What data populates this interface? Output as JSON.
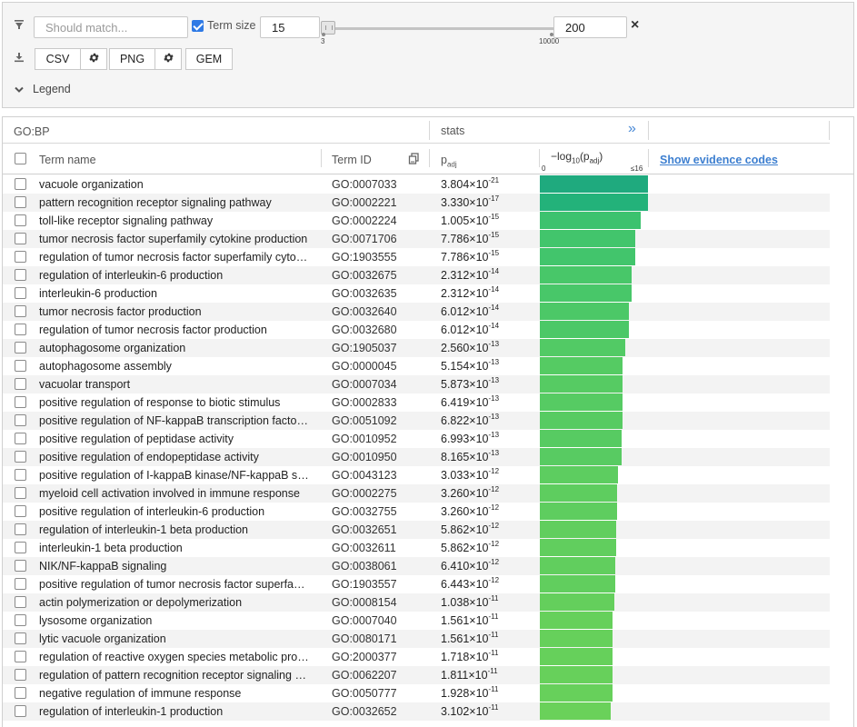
{
  "filters": {
    "search_placeholder": "Should match...",
    "term_size_label": "Term size",
    "term_size_checked": true,
    "term_size_min": "15",
    "term_size_max": "200",
    "slider_min_label": "3",
    "slider_max_label": "10000",
    "clear_icon": "×",
    "export_buttons": [
      "CSV",
      "PNG",
      "GEM"
    ],
    "legend_label": "Legend"
  },
  "table": {
    "source_label": "GO:BP",
    "stats_label": "stats",
    "expand_icon": "»",
    "col_term_name": "Term name",
    "col_term_id": "Term ID",
    "col_padj": "p",
    "col_padj_sub": "adj",
    "col_neglog_prefix": "−log",
    "col_neglog_sub": "10",
    "col_neglog_inner": "(p",
    "col_neglog_inner_sub": "adj",
    "col_neglog_close": ")",
    "axis_min": "0",
    "axis_max": "≤16",
    "show_evidence": "Show evidence codes",
    "rows": [
      {
        "name": "vacuole organization",
        "id": "GO:0007033",
        "mant": "3.804",
        "exp": "-21",
        "neglog": 20.42,
        "color": "#1faa7e"
      },
      {
        "name": "pattern recognition receptor signaling pathway",
        "id": "GO:0002221",
        "mant": "3.330",
        "exp": "-17",
        "neglog": 16.48,
        "color": "#23b27a"
      },
      {
        "name": "toll-like receptor signaling pathway",
        "id": "GO:0002224",
        "mant": "1.005",
        "exp": "-15",
        "neglog": 14.99,
        "color": "#3cc26e"
      },
      {
        "name": "tumor necrosis factor superfamily cytokine production",
        "id": "GO:0071706",
        "mant": "7.786",
        "exp": "-15",
        "neglog": 14.11,
        "color": "#42c56c"
      },
      {
        "name": "regulation of tumor necrosis factor superfamily cytokine production",
        "id": "GO:1903555",
        "mant": "7.786",
        "exp": "-15",
        "neglog": 14.11,
        "color": "#42c56c"
      },
      {
        "name": "regulation of interleukin-6 production",
        "id": "GO:0032675",
        "mant": "2.312",
        "exp": "-14",
        "neglog": 13.64,
        "color": "#48c769"
      },
      {
        "name": "interleukin-6 production",
        "id": "GO:0032635",
        "mant": "2.312",
        "exp": "-14",
        "neglog": 13.64,
        "color": "#48c769"
      },
      {
        "name": "tumor necrosis factor production",
        "id": "GO:0032640",
        "mant": "6.012",
        "exp": "-14",
        "neglog": 13.22,
        "color": "#4cc867"
      },
      {
        "name": "regulation of tumor necrosis factor production",
        "id": "GO:0032680",
        "mant": "6.012",
        "exp": "-14",
        "neglog": 13.22,
        "color": "#4cc867"
      },
      {
        "name": "autophagosome organization",
        "id": "GO:1905037",
        "mant": "2.560",
        "exp": "-13",
        "neglog": 12.59,
        "color": "#52ca65"
      },
      {
        "name": "autophagosome assembly",
        "id": "GO:0000045",
        "mant": "5.154",
        "exp": "-13",
        "neglog": 12.29,
        "color": "#55cb63"
      },
      {
        "name": "vacuolar transport",
        "id": "GO:0007034",
        "mant": "5.873",
        "exp": "-13",
        "neglog": 12.23,
        "color": "#56cb63"
      },
      {
        "name": "positive regulation of response to biotic stimulus",
        "id": "GO:0002833",
        "mant": "6.419",
        "exp": "-13",
        "neglog": 12.19,
        "color": "#56cb63"
      },
      {
        "name": "positive regulation of NF-kappaB transcription factor activity",
        "id": "GO:0051092",
        "mant": "6.822",
        "exp": "-13",
        "neglog": 12.17,
        "color": "#57cb62"
      },
      {
        "name": "positive regulation of peptidase activity",
        "id": "GO:0010952",
        "mant": "6.993",
        "exp": "-13",
        "neglog": 12.16,
        "color": "#57cb62"
      },
      {
        "name": "positive regulation of endopeptidase activity",
        "id": "GO:0010950",
        "mant": "8.165",
        "exp": "-13",
        "neglog": 12.09,
        "color": "#58cb62"
      },
      {
        "name": "positive regulation of I-kappaB kinase/NF-kappaB signaling",
        "id": "GO:0043123",
        "mant": "3.033",
        "exp": "-12",
        "neglog": 11.52,
        "color": "#5dcd60"
      },
      {
        "name": "myeloid cell activation involved in immune response",
        "id": "GO:0002275",
        "mant": "3.260",
        "exp": "-12",
        "neglog": 11.49,
        "color": "#5ecd5f"
      },
      {
        "name": "positive regulation of interleukin-6 production",
        "id": "GO:0032755",
        "mant": "3.260",
        "exp": "-12",
        "neglog": 11.49,
        "color": "#5ecd5f"
      },
      {
        "name": "regulation of interleukin-1 beta production",
        "id": "GO:0032651",
        "mant": "5.862",
        "exp": "-12",
        "neglog": 11.23,
        "color": "#61ce5e"
      },
      {
        "name": "interleukin-1 beta production",
        "id": "GO:0032611",
        "mant": "5.862",
        "exp": "-12",
        "neglog": 11.23,
        "color": "#61ce5e"
      },
      {
        "name": "NIK/NF-kappaB signaling",
        "id": "GO:0038061",
        "mant": "6.410",
        "exp": "-12",
        "neglog": 11.19,
        "color": "#61ce5e"
      },
      {
        "name": "positive regulation of tumor necrosis factor superfamily cytokine production",
        "id": "GO:1903557",
        "mant": "6.443",
        "exp": "-12",
        "neglog": 11.19,
        "color": "#61ce5e"
      },
      {
        "name": "actin polymerization or depolymerization",
        "id": "GO:0008154",
        "mant": "1.038",
        "exp": "-11",
        "neglog": 10.98,
        "color": "#64cf5c"
      },
      {
        "name": "lysosome organization",
        "id": "GO:0007040",
        "mant": "1.561",
        "exp": "-11",
        "neglog": 10.81,
        "color": "#66d05b"
      },
      {
        "name": "lytic vacuole organization",
        "id": "GO:0080171",
        "mant": "1.561",
        "exp": "-11",
        "neglog": 10.81,
        "color": "#66d05b"
      },
      {
        "name": "regulation of reactive oxygen species metabolic process",
        "id": "GO:2000377",
        "mant": "1.718",
        "exp": "-11",
        "neglog": 10.77,
        "color": "#66d05b"
      },
      {
        "name": "regulation of pattern recognition receptor signaling pathway",
        "id": "GO:0062207",
        "mant": "1.811",
        "exp": "-11",
        "neglog": 10.74,
        "color": "#67d05b"
      },
      {
        "name": "negative regulation of immune response",
        "id": "GO:0050777",
        "mant": "1.928",
        "exp": "-11",
        "neglog": 10.71,
        "color": "#67d05b"
      },
      {
        "name": "regulation of interleukin-1 production",
        "id": "GO:0032652",
        "mant": "3.102",
        "exp": "-11",
        "neglog": 10.51,
        "color": "#6ad15a"
      }
    ]
  }
}
